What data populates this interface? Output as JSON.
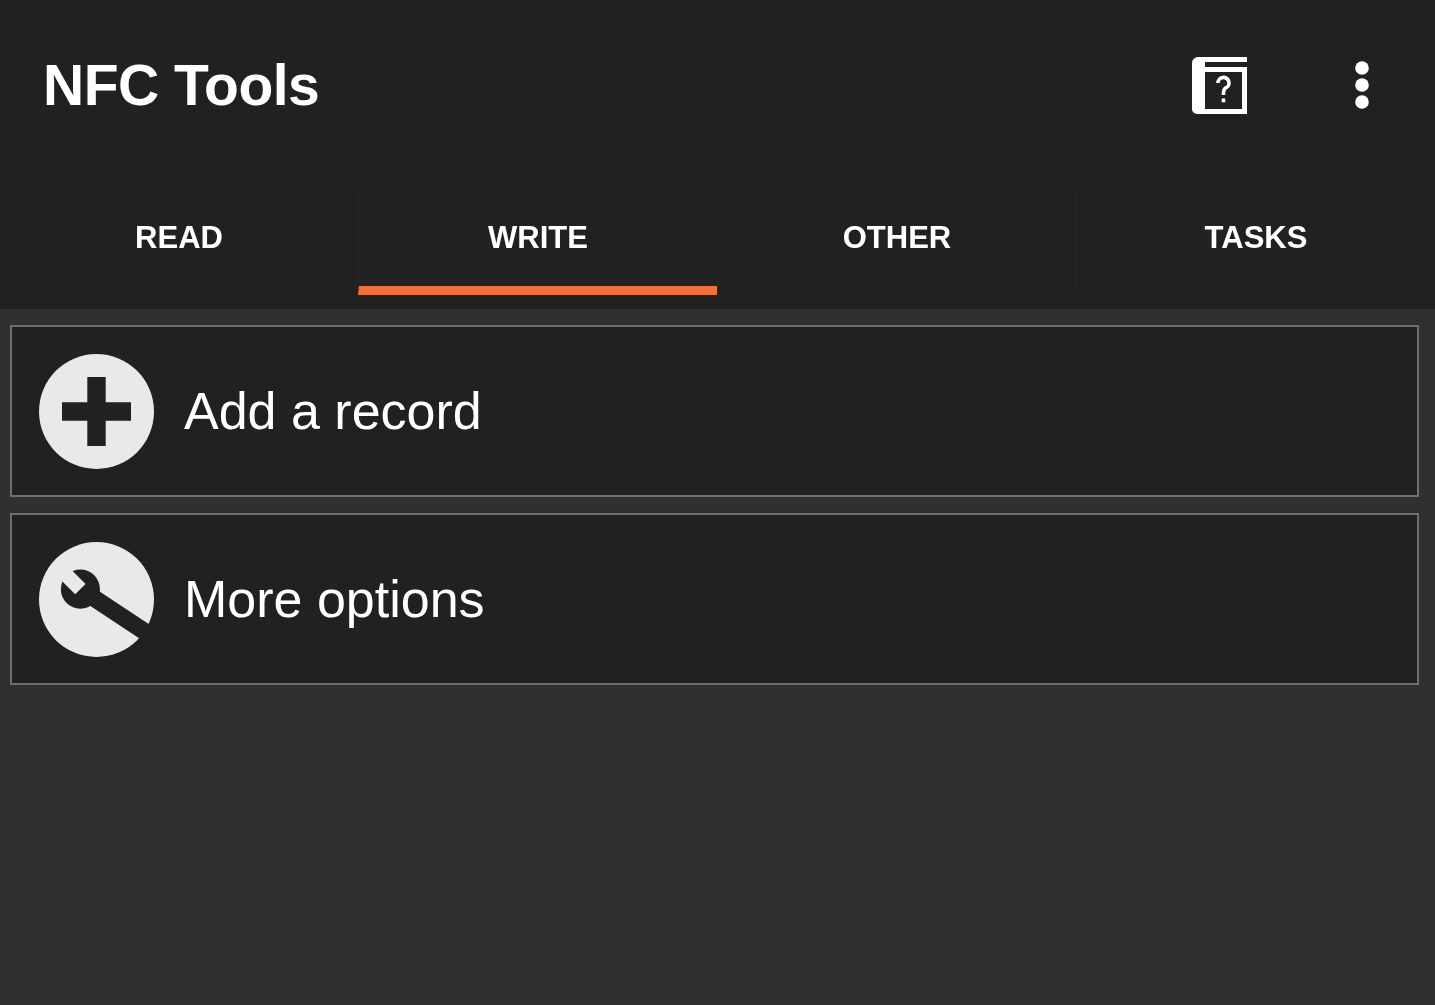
{
  "app_bar": {
    "title": "NFC Tools"
  },
  "tabs": [
    {
      "label": "READ",
      "selected": false
    },
    {
      "label": "WRITE",
      "selected": true
    },
    {
      "label": "OTHER",
      "selected": false
    },
    {
      "label": "TASKS",
      "selected": false
    }
  ],
  "options": [
    {
      "kind": "add",
      "label": "Add a record"
    },
    {
      "kind": "tools",
      "label": "More options"
    }
  ]
}
